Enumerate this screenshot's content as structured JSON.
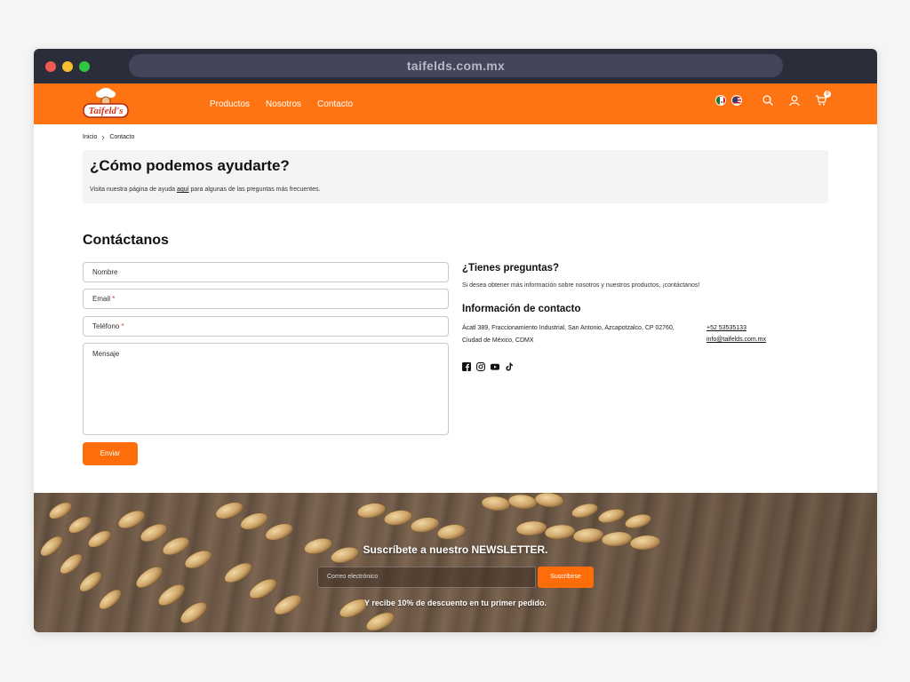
{
  "browser": {
    "url": "taifelds.com.mx"
  },
  "header": {
    "logo_text": "Taifeld's",
    "nav": [
      {
        "label": "Productos"
      },
      {
        "label": "Nosotros"
      },
      {
        "label": "Contacto"
      }
    ],
    "cart_count": "0"
  },
  "breadcrumb": {
    "home": "Inicio",
    "current": "Contacto"
  },
  "help": {
    "title": "¿Cómo podemos ayudarte?",
    "text_before": "Visita nuestra página de ayuda ",
    "link": "aquí",
    "text_after": " para algunas de las preguntas más frecuentes."
  },
  "contact": {
    "title": "Contáctanos",
    "fields": {
      "name": "Nombre",
      "email": "Email",
      "phone": "Teléfono",
      "message": "Mensaje",
      "required_mark": "*"
    },
    "submit_label": "Enviar"
  },
  "info": {
    "questions_title": "¿Tienes preguntas?",
    "questions_text": "Si desea obtener más información sobre nosotros y nuestros productos, ¡contáctanos!",
    "contact_title": "Información de contacto",
    "address_line1": "Ácatl 389, Fraccionamiento Industrial, San Antonio, Azcapotzalco, CP 02760,",
    "address_line2": "Ciudad de México, CDMX",
    "phone": "+52 53535133",
    "email": "info@taifelds.com.mx",
    "socials": [
      "facebook-icon",
      "instagram-icon",
      "youtube-icon",
      "tiktok-icon"
    ]
  },
  "newsletter": {
    "title": "Suscríbete a nuestro NEWSLETTER.",
    "placeholder": "Correo electrónico",
    "button": "Suscribirse",
    "subtitle": "Y recibe 10% de descuento en tu primer pedido."
  },
  "colors": {
    "brand_orange": "#ff7412",
    "button_orange": "#ff6d0a",
    "titlebar": "#2b2d3a"
  }
}
